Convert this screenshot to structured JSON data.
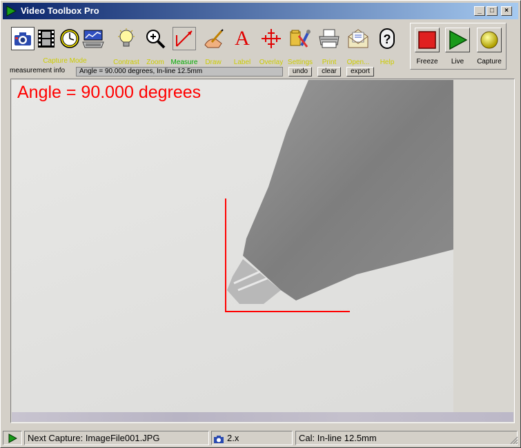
{
  "window": {
    "title": "Video Toolbox Pro"
  },
  "toolbar": {
    "capture_mode_label": "Capture Mode",
    "tools": [
      {
        "label": "Contrast",
        "icon": "lightbulb-icon"
      },
      {
        "label": "Zoom",
        "icon": "magnifier-icon"
      },
      {
        "label": "Measure",
        "icon": "measure-icon"
      },
      {
        "label": "Draw",
        "icon": "pencil-hand-icon"
      },
      {
        "label": "Label",
        "icon": "letter-a-icon"
      },
      {
        "label": "Overlay",
        "icon": "crosshair-icon"
      },
      {
        "label": "Settings",
        "icon": "tools-icon"
      },
      {
        "label": "Print",
        "icon": "printer-icon"
      },
      {
        "label": "Open...",
        "icon": "open-envelope-icon"
      },
      {
        "label": "Help",
        "icon": "help-icon"
      }
    ],
    "controls": [
      {
        "label": "Freeze",
        "icon": "stop-square-icon",
        "color": "#e02020"
      },
      {
        "label": "Live",
        "icon": "play-triangle-icon",
        "color": "#1a9a1a"
      },
      {
        "label": "Capture",
        "icon": "yellow-ball-icon",
        "color": "#e0d000"
      }
    ]
  },
  "measurement": {
    "label": "measurement info",
    "value": "Angle = 90.000 degrees, In-line 12.5mm",
    "undo_label": "undo",
    "clear_label": "clear",
    "export_label": "export"
  },
  "viewer": {
    "angle_text": "Angle = 90.000 degrees",
    "angle_color": "#ff0000"
  },
  "status": {
    "next_capture": "Next Capture: ImageFile001.JPG",
    "zoom": "2.x",
    "calibration": "Cal: In-line 12.5mm"
  },
  "colors": {
    "title_start": "#0a246a",
    "title_end": "#a6caf0",
    "label_yellow": "#cccc00",
    "label_green": "#00aa00"
  }
}
